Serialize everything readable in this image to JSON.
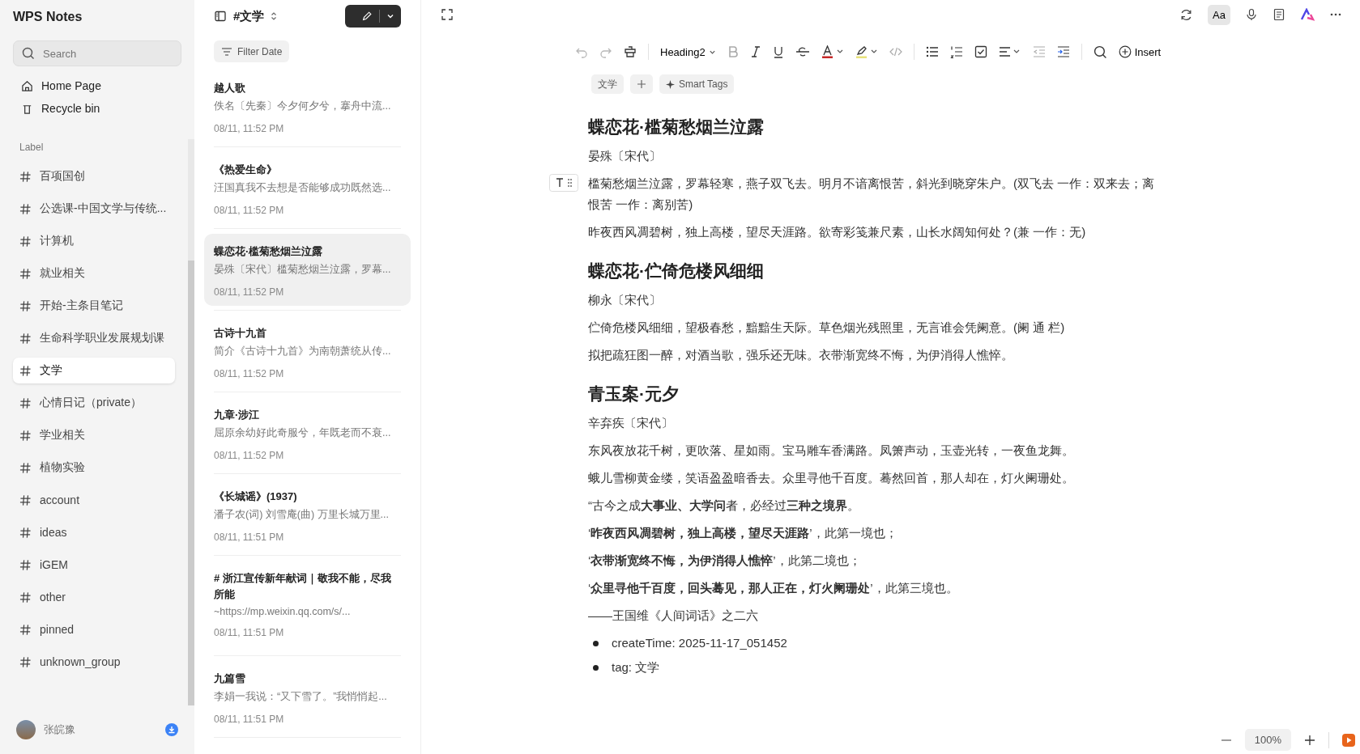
{
  "app": {
    "title": "WPS Notes"
  },
  "search": {
    "placeholder": "Search"
  },
  "nav": [
    {
      "label": "Home Page"
    },
    {
      "label": "Recycle bin"
    }
  ],
  "labels_heading": "Label",
  "labels": [
    {
      "label": "百项国创",
      "selected": false
    },
    {
      "label": "公选课-中国文学与传统...",
      "selected": false
    },
    {
      "label": "计算机",
      "selected": false
    },
    {
      "label": "就业相关",
      "selected": false
    },
    {
      "label": "开始-主条目笔记",
      "selected": false
    },
    {
      "label": "生命科学职业发展规划课",
      "selected": false
    },
    {
      "label": "文学",
      "selected": true
    },
    {
      "label": "心情日记（private）",
      "selected": false
    },
    {
      "label": "学业相关",
      "selected": false
    },
    {
      "label": "植物实验",
      "selected": false
    },
    {
      "label": "account",
      "selected": false
    },
    {
      "label": "ideas",
      "selected": false
    },
    {
      "label": "iGEM",
      "selected": false
    },
    {
      "label": "other",
      "selected": false
    },
    {
      "label": "pinned",
      "selected": false
    },
    {
      "label": "unknown_group",
      "selected": false
    }
  ],
  "user": {
    "name": "张皖豫"
  },
  "list": {
    "title": "#文学",
    "filter": "Filter Date",
    "notes": [
      {
        "title": "越人歌",
        "preview": "佚名〔先秦〕今夕何夕兮，搴舟中流...",
        "time": "08/11, 11:52 PM",
        "selected": false
      },
      {
        "title": "《热爱生命》",
        "preview": "汪国真我不去想是否能够成功既然选...",
        "time": "08/11, 11:52 PM",
        "selected": false
      },
      {
        "title": "蝶恋花·槛菊愁烟兰泣露",
        "preview": "晏殊〔宋代〕槛菊愁烟兰泣露，罗幕...",
        "time": "08/11, 11:52 PM",
        "selected": true
      },
      {
        "title": "古诗十九首",
        "preview": "简介《古诗十九首》为南朝萧统从传...",
        "time": "08/11, 11:52 PM",
        "selected": false
      },
      {
        "title": "九章·涉江",
        "preview": "屈原余幼好此奇服兮，年既老而不衰...",
        "time": "08/11, 11:52 PM",
        "selected": false
      },
      {
        "title": "《长城谣》(1937)",
        "preview": "潘子农(词) 刘雪庵(曲) 万里长城万里...",
        "time": "08/11, 11:51 PM",
        "selected": false
      },
      {
        "title": "# 浙江宣传新年献词｜敬我不能，尽我所能",
        "preview": "~https://mp.weixin.qq.com/s/...",
        "time": "08/11, 11:51 PM",
        "selected": false
      },
      {
        "title": "九篇雪",
        "preview": "李娟一我说：“又下雪了。”我悄悄起...",
        "time": "08/11, 11:51 PM",
        "selected": false
      }
    ]
  },
  "toolbar": {
    "font_button": {
      "label": "Aa",
      "selected": true
    },
    "undo": {
      "disabled": true
    },
    "redo": {
      "disabled": true
    },
    "style": "Heading2",
    "insert": "Insert"
  },
  "tags": {
    "items": [
      "文学"
    ],
    "smart": "Smart Tags"
  },
  "doc": [
    {
      "kind": "heading",
      "text": "蝶恋花·槛菊愁烟兰泣露"
    },
    {
      "kind": "author",
      "text": "晏殊〔宋代〕"
    },
    {
      "kind": "text",
      "text": "槛菊愁烟兰泣露，罗幕轻寒，燕子双飞去。明月不谙离恨苦，斜光到晓穿朱户。(双飞去 一作：双来去；离恨苦 一作：离别苦)",
      "handle": true
    },
    {
      "kind": "text",
      "text": "昨夜西风凋碧树，独上高楼，望尽天涯路。欲寄彩笺兼尺素，山长水阔知何处？(兼 一作：无)"
    },
    {
      "kind": "heading",
      "text": "蝶恋花·伫倚危楼风细细"
    },
    {
      "kind": "author",
      "text": "柳永〔宋代〕"
    },
    {
      "kind": "text",
      "text": "伫倚危楼风细细，望极春愁，黯黯生天际。草色烟光残照里，无言谁会凭阑意。(阑 通 栏)"
    },
    {
      "kind": "text",
      "text": "拟把疏狂图一醉，对酒当歌，强乐还无味。衣带渐宽终不悔，为伊消得人憔悴。"
    },
    {
      "kind": "heading",
      "text": "青玉案·元夕"
    },
    {
      "kind": "author",
      "text": "辛弃疾〔宋代〕"
    },
    {
      "kind": "text",
      "text": "东风夜放花千树，更吹落、星如雨。宝马雕车香满路。凤箫声动，玉壶光转，一夜鱼龙舞。"
    },
    {
      "kind": "text",
      "text": "蛾儿雪柳黄金缕，笑语盈盈暗香去。众里寻他千百度。蓦然回首，那人却在，灯火阑珊处。"
    },
    {
      "kind": "text",
      "text": "“古今之成**大事业、大学问**者，必经过**三种之境界**。"
    },
    {
      "kind": "text",
      "text": "‘**昨夜西风凋碧树，独上高楼，望尽天涯路**’，此第一境也；"
    },
    {
      "kind": "text",
      "text": "‘**衣带渐宽终不悔，为伊消得人憔悴**’，此第二境也；"
    },
    {
      "kind": "text",
      "text": "‘**众里寻他千百度，回头蓦见，那人正在，灯火阑珊处**’，此第三境也。"
    },
    {
      "kind": "text",
      "text": "——王国维《人间词话》之二六"
    },
    {
      "kind": "bullet",
      "text": "createTime: 2025-11-17_051452"
    },
    {
      "kind": "bullet",
      "text": "tag: 文学"
    }
  ],
  "zoom": {
    "value": "100%"
  }
}
